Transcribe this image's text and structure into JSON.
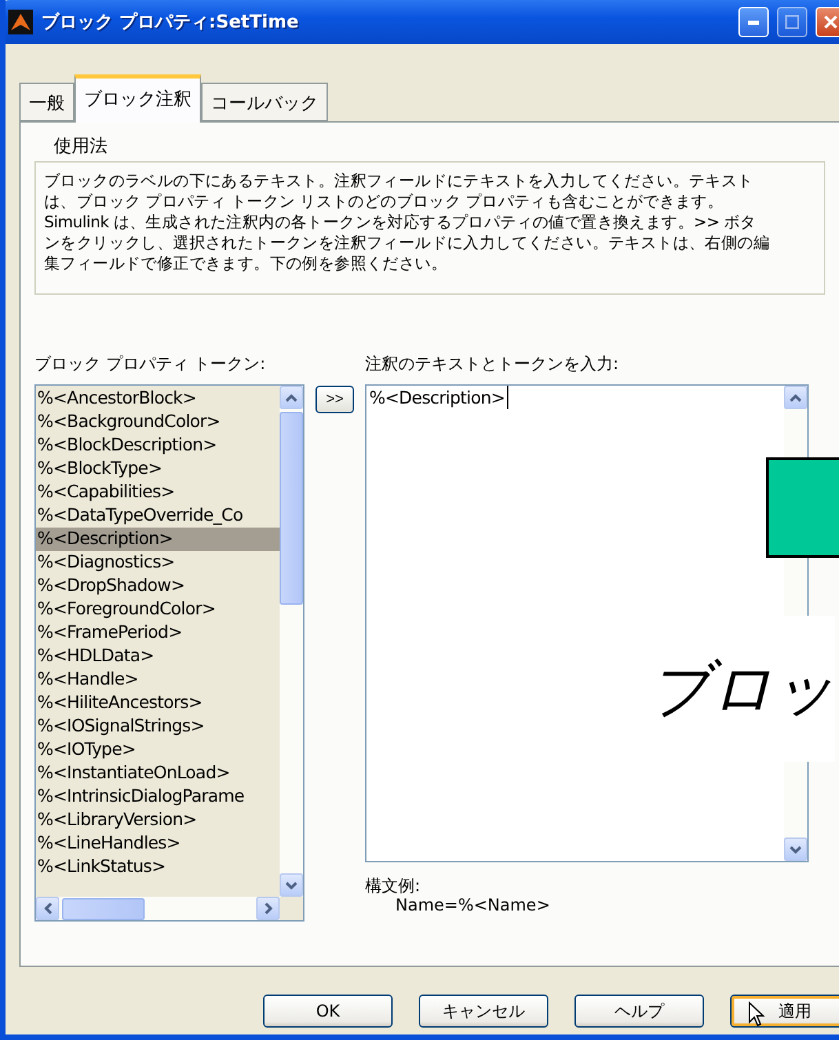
{
  "window": {
    "title": "ブロック プロパティ:SetTime"
  },
  "tabs": [
    {
      "label": "一般",
      "selected": false
    },
    {
      "label": "ブロック注釈",
      "selected": true
    },
    {
      "label": "コールバック",
      "selected": false
    }
  ],
  "usage": {
    "title": "使用法",
    "text": "ブロックのラベルの下にあるテキスト。注釈フィールドにテキストを入力してください。テキストは、ブロック プロパティ トークン リストのどのブロック プロパティも含むことができます。Simulink は、生成された注釈内の各トークンを対応するプロパティの値で置き換えます。>> ボタンをクリックし、選択されたトークンを注釈フィールドに入力してください。テキストは、右側の編集フィールドで修正できます。下の例を参照ください。"
  },
  "tokens": {
    "label": "ブロック プロパティ トークン:",
    "items": [
      {
        "text": "%<AncestorBlock>",
        "selected": false
      },
      {
        "text": "%<BackgroundColor>",
        "selected": false
      },
      {
        "text": "%<BlockDescription>",
        "selected": false
      },
      {
        "text": "%<BlockType>",
        "selected": false
      },
      {
        "text": "%<Capabilities>",
        "selected": false
      },
      {
        "text": "%<DataTypeOverride_Co",
        "selected": false
      },
      {
        "text": "%<Description>",
        "selected": true
      },
      {
        "text": "%<Diagnostics>",
        "selected": false
      },
      {
        "text": "%<DropShadow>",
        "selected": false
      },
      {
        "text": "%<ForegroundColor>",
        "selected": false
      },
      {
        "text": "%<FramePeriod>",
        "selected": false
      },
      {
        "text": "%<HDLData>",
        "selected": false
      },
      {
        "text": "%<Handle>",
        "selected": false
      },
      {
        "text": "%<HiliteAncestors>",
        "selected": false
      },
      {
        "text": "%<IOSignalStrings>",
        "selected": false
      },
      {
        "text": "%<IOType>",
        "selected": false
      },
      {
        "text": "%<InstantiateOnLoad>",
        "selected": false
      },
      {
        "text": "%<IntrinsicDialogParame",
        "selected": false
      },
      {
        "text": "%<LibraryVersion>",
        "selected": false
      },
      {
        "text": "%<LineHandles>",
        "selected": false
      },
      {
        "text": "%<LinkStatus>",
        "selected": false
      }
    ]
  },
  "insert_button": ">>",
  "annotation": {
    "label": "注釈のテキストとトークンを入力:",
    "value": "%<Description>"
  },
  "syntax": {
    "label": "構文例:",
    "example": "Name=%<Name>"
  },
  "buttons": [
    {
      "label": "OK",
      "hovered": false
    },
    {
      "label": "キャンセル",
      "hovered": false
    },
    {
      "label": "ヘルプ",
      "hovered": false
    },
    {
      "label": "適用",
      "hovered": true
    }
  ],
  "overlay": {
    "text": "ブロッ"
  }
}
